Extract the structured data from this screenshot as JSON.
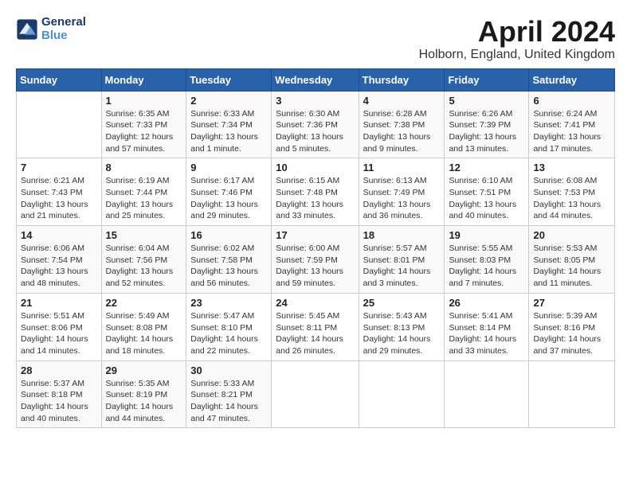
{
  "header": {
    "logo_line1": "General",
    "logo_line2": "Blue",
    "month_title": "April 2024",
    "location": "Holborn, England, United Kingdom"
  },
  "weekdays": [
    "Sunday",
    "Monday",
    "Tuesday",
    "Wednesday",
    "Thursday",
    "Friday",
    "Saturday"
  ],
  "weeks": [
    [
      {
        "day": "",
        "sunrise": "",
        "sunset": "",
        "daylight": ""
      },
      {
        "day": "1",
        "sunrise": "Sunrise: 6:35 AM",
        "sunset": "Sunset: 7:33 PM",
        "daylight": "Daylight: 12 hours and 57 minutes."
      },
      {
        "day": "2",
        "sunrise": "Sunrise: 6:33 AM",
        "sunset": "Sunset: 7:34 PM",
        "daylight": "Daylight: 13 hours and 1 minute."
      },
      {
        "day": "3",
        "sunrise": "Sunrise: 6:30 AM",
        "sunset": "Sunset: 7:36 PM",
        "daylight": "Daylight: 13 hours and 5 minutes."
      },
      {
        "day": "4",
        "sunrise": "Sunrise: 6:28 AM",
        "sunset": "Sunset: 7:38 PM",
        "daylight": "Daylight: 13 hours and 9 minutes."
      },
      {
        "day": "5",
        "sunrise": "Sunrise: 6:26 AM",
        "sunset": "Sunset: 7:39 PM",
        "daylight": "Daylight: 13 hours and 13 minutes."
      },
      {
        "day": "6",
        "sunrise": "Sunrise: 6:24 AM",
        "sunset": "Sunset: 7:41 PM",
        "daylight": "Daylight: 13 hours and 17 minutes."
      }
    ],
    [
      {
        "day": "7",
        "sunrise": "Sunrise: 6:21 AM",
        "sunset": "Sunset: 7:43 PM",
        "daylight": "Daylight: 13 hours and 21 minutes."
      },
      {
        "day": "8",
        "sunrise": "Sunrise: 6:19 AM",
        "sunset": "Sunset: 7:44 PM",
        "daylight": "Daylight: 13 hours and 25 minutes."
      },
      {
        "day": "9",
        "sunrise": "Sunrise: 6:17 AM",
        "sunset": "Sunset: 7:46 PM",
        "daylight": "Daylight: 13 hours and 29 minutes."
      },
      {
        "day": "10",
        "sunrise": "Sunrise: 6:15 AM",
        "sunset": "Sunset: 7:48 PM",
        "daylight": "Daylight: 13 hours and 33 minutes."
      },
      {
        "day": "11",
        "sunrise": "Sunrise: 6:13 AM",
        "sunset": "Sunset: 7:49 PM",
        "daylight": "Daylight: 13 hours and 36 minutes."
      },
      {
        "day": "12",
        "sunrise": "Sunrise: 6:10 AM",
        "sunset": "Sunset: 7:51 PM",
        "daylight": "Daylight: 13 hours and 40 minutes."
      },
      {
        "day": "13",
        "sunrise": "Sunrise: 6:08 AM",
        "sunset": "Sunset: 7:53 PM",
        "daylight": "Daylight: 13 hours and 44 minutes."
      }
    ],
    [
      {
        "day": "14",
        "sunrise": "Sunrise: 6:06 AM",
        "sunset": "Sunset: 7:54 PM",
        "daylight": "Daylight: 13 hours and 48 minutes."
      },
      {
        "day": "15",
        "sunrise": "Sunrise: 6:04 AM",
        "sunset": "Sunset: 7:56 PM",
        "daylight": "Daylight: 13 hours and 52 minutes."
      },
      {
        "day": "16",
        "sunrise": "Sunrise: 6:02 AM",
        "sunset": "Sunset: 7:58 PM",
        "daylight": "Daylight: 13 hours and 56 minutes."
      },
      {
        "day": "17",
        "sunrise": "Sunrise: 6:00 AM",
        "sunset": "Sunset: 7:59 PM",
        "daylight": "Daylight: 13 hours and 59 minutes."
      },
      {
        "day": "18",
        "sunrise": "Sunrise: 5:57 AM",
        "sunset": "Sunset: 8:01 PM",
        "daylight": "Daylight: 14 hours and 3 minutes."
      },
      {
        "day": "19",
        "sunrise": "Sunrise: 5:55 AM",
        "sunset": "Sunset: 8:03 PM",
        "daylight": "Daylight: 14 hours and 7 minutes."
      },
      {
        "day": "20",
        "sunrise": "Sunrise: 5:53 AM",
        "sunset": "Sunset: 8:05 PM",
        "daylight": "Daylight: 14 hours and 11 minutes."
      }
    ],
    [
      {
        "day": "21",
        "sunrise": "Sunrise: 5:51 AM",
        "sunset": "Sunset: 8:06 PM",
        "daylight": "Daylight: 14 hours and 14 minutes."
      },
      {
        "day": "22",
        "sunrise": "Sunrise: 5:49 AM",
        "sunset": "Sunset: 8:08 PM",
        "daylight": "Daylight: 14 hours and 18 minutes."
      },
      {
        "day": "23",
        "sunrise": "Sunrise: 5:47 AM",
        "sunset": "Sunset: 8:10 PM",
        "daylight": "Daylight: 14 hours and 22 minutes."
      },
      {
        "day": "24",
        "sunrise": "Sunrise: 5:45 AM",
        "sunset": "Sunset: 8:11 PM",
        "daylight": "Daylight: 14 hours and 26 minutes."
      },
      {
        "day": "25",
        "sunrise": "Sunrise: 5:43 AM",
        "sunset": "Sunset: 8:13 PM",
        "daylight": "Daylight: 14 hours and 29 minutes."
      },
      {
        "day": "26",
        "sunrise": "Sunrise: 5:41 AM",
        "sunset": "Sunset: 8:14 PM",
        "daylight": "Daylight: 14 hours and 33 minutes."
      },
      {
        "day": "27",
        "sunrise": "Sunrise: 5:39 AM",
        "sunset": "Sunset: 8:16 PM",
        "daylight": "Daylight: 14 hours and 37 minutes."
      }
    ],
    [
      {
        "day": "28",
        "sunrise": "Sunrise: 5:37 AM",
        "sunset": "Sunset: 8:18 PM",
        "daylight": "Daylight: 14 hours and 40 minutes."
      },
      {
        "day": "29",
        "sunrise": "Sunrise: 5:35 AM",
        "sunset": "Sunset: 8:19 PM",
        "daylight": "Daylight: 14 hours and 44 minutes."
      },
      {
        "day": "30",
        "sunrise": "Sunrise: 5:33 AM",
        "sunset": "Sunset: 8:21 PM",
        "daylight": "Daylight: 14 hours and 47 minutes."
      },
      {
        "day": "",
        "sunrise": "",
        "sunset": "",
        "daylight": ""
      },
      {
        "day": "",
        "sunrise": "",
        "sunset": "",
        "daylight": ""
      },
      {
        "day": "",
        "sunrise": "",
        "sunset": "",
        "daylight": ""
      },
      {
        "day": "",
        "sunrise": "",
        "sunset": "",
        "daylight": ""
      }
    ]
  ]
}
